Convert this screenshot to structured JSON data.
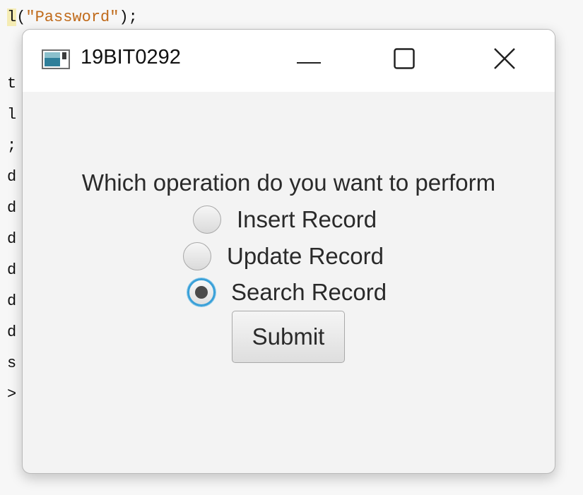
{
  "editor": {
    "top_line_prefix": "l",
    "top_line_open": "(",
    "top_line_string": "\"Password\"",
    "top_line_close": ");",
    "gutter_lines": [
      "t",
      "l",
      ";",
      "d",
      "d",
      "d",
      "d",
      "d",
      "d",
      "s",
      ">"
    ]
  },
  "window": {
    "title": "19BIT0292",
    "question": "Which operation do you want to perform",
    "options": [
      {
        "label": "Insert Record",
        "selected": false
      },
      {
        "label": "Update Record",
        "selected": false
      },
      {
        "label": "Search Record",
        "selected": true
      }
    ],
    "submit_label": "Submit"
  },
  "icons": {
    "app": "app-window-icon",
    "minimize": "minimize-icon",
    "maximize": "maximize-icon",
    "close": "close-icon"
  },
  "colors": {
    "focus_ring": "#3aa0d8",
    "string_literal": "#c06a1a",
    "highlight": "#f5ecb4"
  }
}
